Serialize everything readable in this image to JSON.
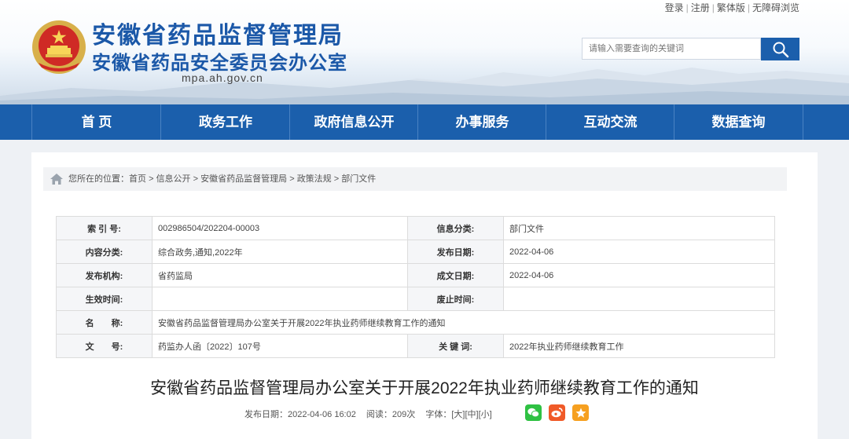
{
  "header": {
    "title": "安徽省药品监督管理局",
    "subtitle": "安徽省药品安全委员会办公室",
    "domain": "mpa.ah.gov.cn",
    "top_links": [
      "登录",
      "注册",
      "繁体版",
      "无障碍浏览"
    ],
    "search_placeholder": "请输入需要查询的关键词"
  },
  "nav": [
    "首 页",
    "政务工作",
    "政府信息公开",
    "办事服务",
    "互动交流",
    "数据查询"
  ],
  "breadcrumb": {
    "label": "您所在的位置：",
    "items": [
      "首页",
      "信息公开",
      "安徽省药品监督管理局",
      "政策法规",
      "部门文件"
    ],
    "separator": ">"
  },
  "info_table": {
    "rows": [
      {
        "label1": "索 引 号:",
        "value1": "002986504/202204-00003",
        "label2": "信息分类:",
        "value2": "部门文件"
      },
      {
        "label1": "内容分类:",
        "value1": "综合政务,通知,2022年",
        "label2": "发布日期:",
        "value2": "2022-04-06"
      },
      {
        "label1": "发布机构:",
        "value1": "省药监局",
        "label2": "成文日期:",
        "value2": "2022-04-06"
      },
      {
        "label1": "生效时间:",
        "value1": "",
        "label2": "废止时间:",
        "value2": ""
      }
    ],
    "name_label": "名　　称:",
    "name_value": "安徽省药品监督管理局办公室关于开展2022年执业药师继续教育工作的通知",
    "doc_label": "文　　号:",
    "doc_value": "药监办人函〔2022〕107号",
    "keyword_label": "关 键 词:",
    "keyword_value": "2022年执业药师继续教育工作"
  },
  "article": {
    "title": "安徽省药品监督管理局办公室关于开展2022年执业药师继续教育工作的通知",
    "publish_label": "发布日期：",
    "publish_date": "2022-04-06 16:02",
    "views_label": "阅读：",
    "views": "209次",
    "font_label": "字体：",
    "font_sizes": [
      "[大]",
      "[中]",
      "[小]"
    ],
    "share_icons": [
      "wechat-icon",
      "weibo-icon",
      "favorite-icon"
    ]
  },
  "colors": {
    "brand_blue": "#1b5fac",
    "title_blue": "#1b58a8",
    "wechat_green": "#2fc143",
    "weibo_orange": "#f05a28",
    "favorite_orange": "#f6a020"
  }
}
